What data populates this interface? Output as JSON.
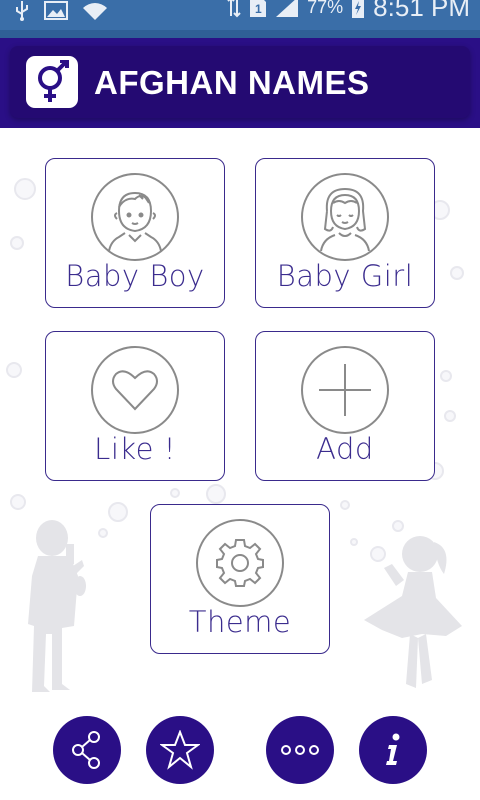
{
  "status_bar": {
    "battery_percent": "77%",
    "time": "8:51 PM"
  },
  "app_bar": {
    "title": "AFGHAN NAMES",
    "logo_icon": "gender-symbol-icon"
  },
  "menu": {
    "tiles": [
      {
        "label": "Baby Boy",
        "icon": "baby-boy-icon"
      },
      {
        "label": "Baby Girl",
        "icon": "baby-girl-icon"
      },
      {
        "label": "Like !",
        "icon": "heart-icon"
      },
      {
        "label": "Add",
        "icon": "plus-icon"
      },
      {
        "label": "Theme",
        "icon": "gear-icon"
      }
    ]
  },
  "bottom_bar": {
    "buttons": [
      {
        "icon": "share-icon"
      },
      {
        "icon": "star-icon"
      },
      {
        "icon": "more-icon"
      },
      {
        "icon": "info-icon"
      }
    ]
  },
  "colors": {
    "primary": "#2a0f86",
    "status_bar": "#3a6ea8",
    "tile_border": "#3a2a8c",
    "label_text": "#3b2c8e"
  }
}
